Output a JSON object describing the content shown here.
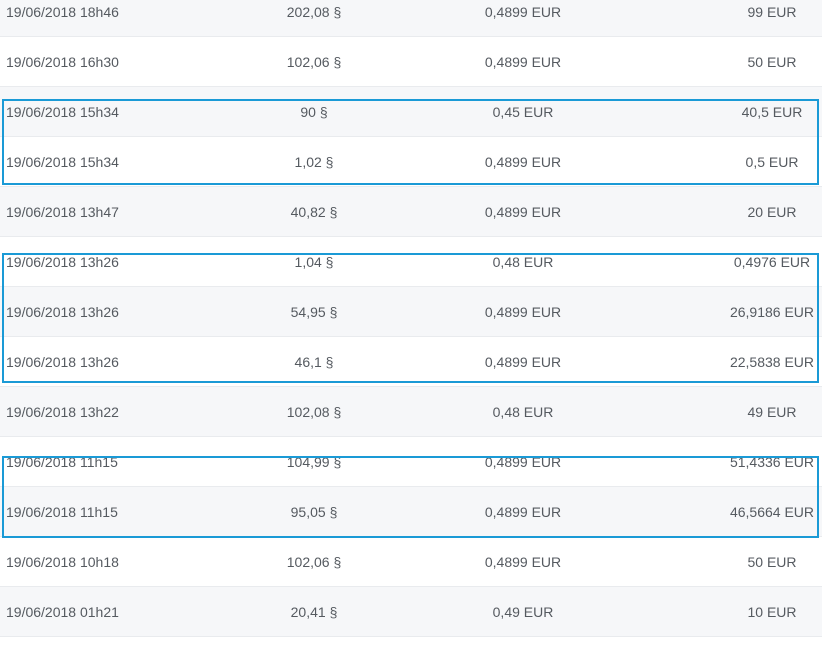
{
  "accent_color": "#1a9ad6",
  "transactions": [
    {
      "date": "19/06/2018 18h46",
      "quantity": "202,08 §",
      "price": "0,4899 EUR",
      "total": "99 EUR"
    },
    {
      "date": "19/06/2018 16h30",
      "quantity": "102,06 §",
      "price": "0,4899 EUR",
      "total": "50 EUR"
    },
    {
      "date": "19/06/2018 15h34",
      "quantity": "90 §",
      "price": "0,45 EUR",
      "total": "40,5 EUR"
    },
    {
      "date": "19/06/2018 15h34",
      "quantity": "1,02 §",
      "price": "0,4899 EUR",
      "total": "0,5 EUR"
    },
    {
      "date": "19/06/2018 13h47",
      "quantity": "40,82 §",
      "price": "0,4899 EUR",
      "total": "20 EUR"
    },
    {
      "date": "19/06/2018 13h26",
      "quantity": "1,04 §",
      "price": "0,48 EUR",
      "total": "0,4976 EUR"
    },
    {
      "date": "19/06/2018 13h26",
      "quantity": "54,95 §",
      "price": "0,4899 EUR",
      "total": "26,9186 EUR"
    },
    {
      "date": "19/06/2018 13h26",
      "quantity": "46,1 §",
      "price": "0,4899 EUR",
      "total": "22,5838 EUR"
    },
    {
      "date": "19/06/2018 13h22",
      "quantity": "102,08 §",
      "price": "0,48 EUR",
      "total": "49 EUR"
    },
    {
      "date": "19/06/2018 11h15",
      "quantity": "104,99 §",
      "price": "0,4899 EUR",
      "total": "51,4336 EUR"
    },
    {
      "date": "19/06/2018 11h15",
      "quantity": "95,05 §",
      "price": "0,4899 EUR",
      "total": "46,5664 EUR"
    },
    {
      "date": "19/06/2018 10h18",
      "quantity": "102,06 §",
      "price": "0,4899 EUR",
      "total": "50 EUR"
    },
    {
      "date": "19/06/2018 01h21",
      "quantity": "20,41 §",
      "price": "0,49 EUR",
      "total": "10 EUR"
    }
  ]
}
